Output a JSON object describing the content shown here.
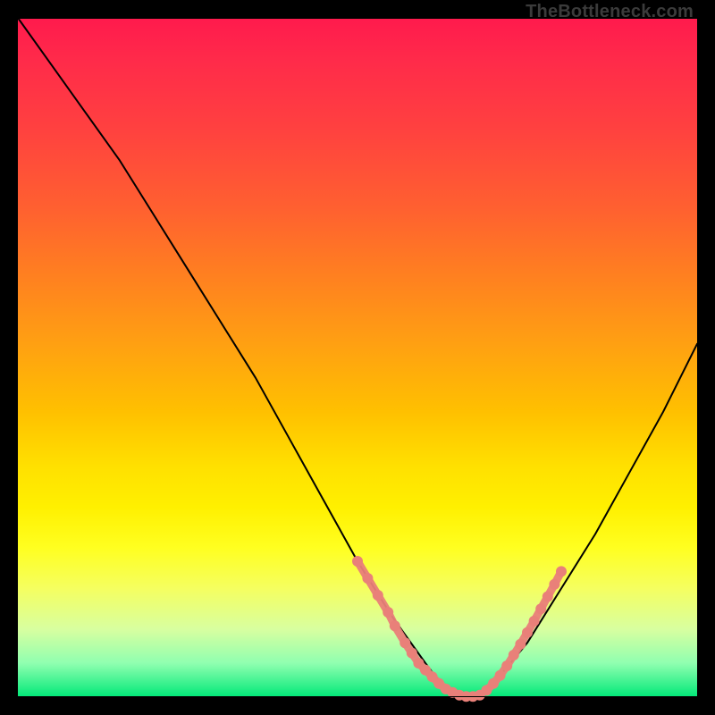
{
  "watermark": "TheBottleneck.com",
  "chart_data": {
    "type": "line",
    "title": "",
    "xlabel": "",
    "ylabel": "",
    "xlim": [
      0,
      100
    ],
    "ylim": [
      0,
      100
    ],
    "grid": false,
    "series": [
      {
        "name": "bottleneck-curve",
        "x": [
          0,
          5,
          10,
          15,
          20,
          25,
          30,
          35,
          40,
          45,
          50,
          55,
          60,
          63,
          67,
          70,
          75,
          80,
          85,
          90,
          95,
          100
        ],
        "y": [
          100,
          93,
          86,
          79,
          71,
          63,
          55,
          47,
          38,
          29,
          20,
          12,
          5,
          1,
          0,
          2,
          8,
          16,
          24,
          33,
          42,
          52
        ]
      }
    ],
    "highlight_clusters": [
      {
        "name": "left-near-min",
        "color": "#e98079",
        "points": [
          {
            "x": 50,
            "y": 20
          },
          {
            "x": 51.5,
            "y": 17.5
          },
          {
            "x": 53,
            "y": 15
          },
          {
            "x": 54.5,
            "y": 12.5
          },
          {
            "x": 55.5,
            "y": 10.5
          },
          {
            "x": 57,
            "y": 8
          },
          {
            "x": 58,
            "y": 6.5
          },
          {
            "x": 59,
            "y": 5
          },
          {
            "x": 60,
            "y": 4
          },
          {
            "x": 61,
            "y": 3
          },
          {
            "x": 62,
            "y": 2
          },
          {
            "x": 63,
            "y": 1.2
          },
          {
            "x": 64,
            "y": 0.7
          },
          {
            "x": 65,
            "y": 0.3
          },
          {
            "x": 66,
            "y": 0.1
          },
          {
            "x": 67,
            "y": 0.1
          },
          {
            "x": 68,
            "y": 0.3
          }
        ]
      },
      {
        "name": "right-near-min",
        "color": "#e98079",
        "points": [
          {
            "x": 69,
            "y": 1
          },
          {
            "x": 70,
            "y": 2
          },
          {
            "x": 71,
            "y": 3.2
          },
          {
            "x": 72,
            "y": 4.6
          },
          {
            "x": 73,
            "y": 6.2
          },
          {
            "x": 74,
            "y": 7.8
          },
          {
            "x": 75,
            "y": 9.5
          },
          {
            "x": 76,
            "y": 11.2
          },
          {
            "x": 77,
            "y": 13
          },
          {
            "x": 78,
            "y": 14.8
          },
          {
            "x": 79,
            "y": 16.6
          },
          {
            "x": 80,
            "y": 18.5
          }
        ]
      }
    ]
  }
}
